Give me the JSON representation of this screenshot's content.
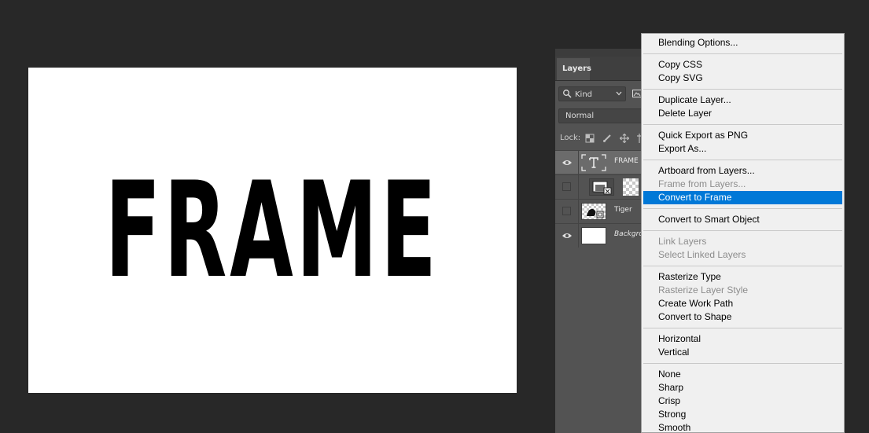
{
  "canvas": {
    "text": "FRAME"
  },
  "layers_panel": {
    "tab_label": "Layers",
    "filter_kind": "Kind",
    "blend_mode": "Normal",
    "lock_label": "Lock:",
    "layers": [
      {
        "name": "FRAME",
        "visible": true,
        "type": "text"
      },
      {
        "name": "",
        "visible": false,
        "type": "frame"
      },
      {
        "name": "Tiger",
        "visible": false,
        "type": "smart-object"
      },
      {
        "name": "Backgro",
        "visible": true,
        "type": "background"
      }
    ]
  },
  "context_menu": {
    "groups": [
      [
        {
          "label": "Blending Options...",
          "enabled": true
        }
      ],
      [
        {
          "label": "Copy CSS",
          "enabled": true
        },
        {
          "label": "Copy SVG",
          "enabled": true
        }
      ],
      [
        {
          "label": "Duplicate Layer...",
          "enabled": true
        },
        {
          "label": "Delete Layer",
          "enabled": true
        }
      ],
      [
        {
          "label": "Quick Export as PNG",
          "enabled": true
        },
        {
          "label": "Export As...",
          "enabled": true
        }
      ],
      [
        {
          "label": "Artboard from Layers...",
          "enabled": true
        },
        {
          "label": "Frame from Layers...",
          "enabled": false
        },
        {
          "label": "Convert to Frame",
          "enabled": true,
          "highlighted": true
        }
      ],
      [
        {
          "label": "Convert to Smart Object",
          "enabled": true
        }
      ],
      [
        {
          "label": "Link Layers",
          "enabled": false
        },
        {
          "label": "Select Linked Layers",
          "enabled": false
        }
      ],
      [
        {
          "label": "Rasterize Type",
          "enabled": true
        },
        {
          "label": "Rasterize Layer Style",
          "enabled": false
        },
        {
          "label": "Create Work Path",
          "enabled": true
        },
        {
          "label": "Convert to Shape",
          "enabled": true
        }
      ],
      [
        {
          "label": "Horizontal",
          "enabled": true
        },
        {
          "label": "Vertical",
          "enabled": true
        }
      ],
      [
        {
          "label": "None",
          "enabled": true
        },
        {
          "label": "Sharp",
          "enabled": true
        },
        {
          "label": "Crisp",
          "enabled": true
        },
        {
          "label": "Strong",
          "enabled": true
        },
        {
          "label": "Smooth",
          "enabled": true
        }
      ]
    ]
  },
  "colors": {
    "app_background": "#282828",
    "panel_background": "#535353",
    "menu_background": "#f0f0f0",
    "menu_highlight": "#0078d7",
    "menu_disabled_text": "#8c8c8c"
  }
}
